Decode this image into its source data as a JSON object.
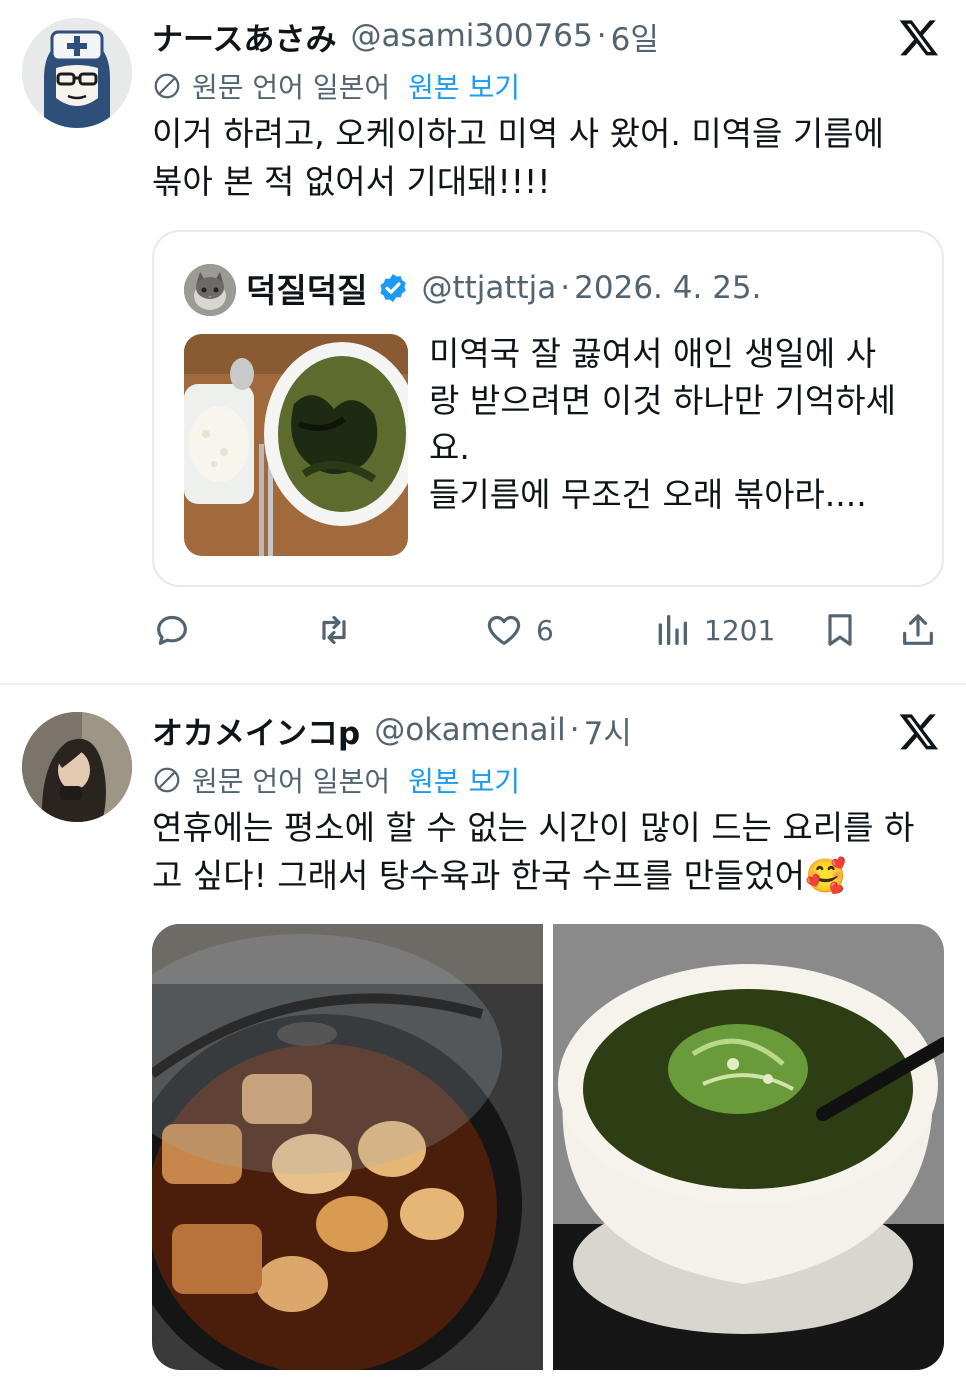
{
  "tweets": [
    {
      "author_name": "ナースあさみ",
      "handle": "@asami300765",
      "separator": "·",
      "time": "6일",
      "translation_note": "원문 언어 일본어",
      "show_original": "원본 보기",
      "text_lines": [
        "이거 하려고, 오케이하고 미역 사 왔어. 미역을 기름에",
        "볶아 본 적 없어서 기대돼!!!!"
      ],
      "quote": {
        "author_name": "덕질덕질",
        "handle": "@ttjattja",
        "separator": "·",
        "date": "2026. 4. 25.",
        "text_lines": [
          "미역국 잘 끓여서 애인 생일에 사",
          "랑 받으려면 이것 하나만 기억하세",
          "요.",
          "들기름에 무조건 오래 볶아라...."
        ]
      },
      "actions": {
        "reply_icon": "reply-icon",
        "retweet_icon": "retweet-icon",
        "like_icon": "heart-icon",
        "like_count": "6",
        "views_icon": "views-icon",
        "views_count": "1201",
        "bookmark_icon": "bookmark-icon",
        "share_icon": "share-icon"
      }
    },
    {
      "author_name": "オカメインコp",
      "handle": "@okamenail",
      "separator": "·",
      "time": "7시",
      "translation_note": "원문 언어 일본어",
      "show_original": "원본 보기",
      "text_lines": [
        "연휴에는 평소에 할 수 없는 시간이 많이 드는 요리를 하",
        "고 싶다! 그래서 탕수육과 한국 수프를 만들었어🥰"
      ]
    }
  ],
  "colors": {
    "text_primary": "#0f1419",
    "text_secondary": "#536471",
    "link": "#1d9bf0",
    "border": "#e6eaed"
  }
}
